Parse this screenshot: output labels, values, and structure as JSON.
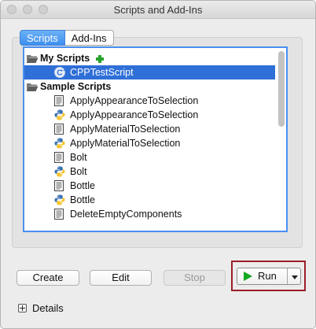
{
  "window": {
    "title": "Scripts and Add-Ins"
  },
  "tabs": [
    {
      "label": "Scripts",
      "active": true
    },
    {
      "label": "Add-Ins",
      "active": false
    }
  ],
  "list": {
    "groups": [
      {
        "label": "My Scripts",
        "icon": "folder-open-icon",
        "add_icon": "add-script-icon",
        "items": [
          {
            "label": "CPPTestScript",
            "icon": "cpp-script-icon",
            "selected": true
          }
        ]
      },
      {
        "label": "Sample Scripts",
        "icon": "folder-open-icon",
        "items": [
          {
            "label": "ApplyAppearanceToSelection",
            "icon": "script-file-icon"
          },
          {
            "label": "ApplyAppearanceToSelection",
            "icon": "python-icon"
          },
          {
            "label": "ApplyMaterialToSelection",
            "icon": "script-file-icon"
          },
          {
            "label": "ApplyMaterialToSelection",
            "icon": "python-icon"
          },
          {
            "label": "Bolt",
            "icon": "script-file-icon"
          },
          {
            "label": "Bolt",
            "icon": "python-icon"
          },
          {
            "label": "Bottle",
            "icon": "script-file-icon"
          },
          {
            "label": "Bottle",
            "icon": "python-icon"
          },
          {
            "label": "DeleteEmptyComponents",
            "icon": "script-file-icon"
          }
        ]
      }
    ]
  },
  "buttons": {
    "create": "Create",
    "edit": "Edit",
    "stop": "Stop",
    "run": "Run"
  },
  "details": {
    "label": "Details"
  },
  "colors": {
    "selection": "#2f6fd8",
    "active_tab": "#3d8ff0",
    "run_highlight": "#9b1e28",
    "run_play": "#13a81f"
  }
}
